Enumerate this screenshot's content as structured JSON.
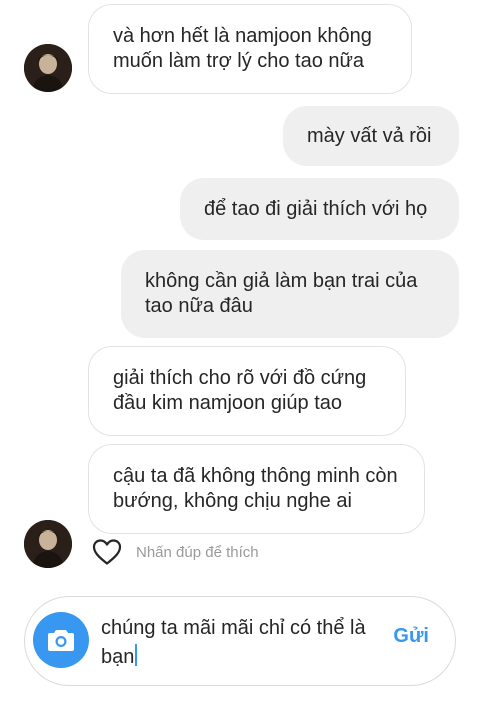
{
  "messages": [
    {
      "side": "incoming",
      "text": "và hơn hết là namjoon không muốn làm trợ lý cho tao nữa"
    },
    {
      "side": "outgoing",
      "text": "mày vất vả rồi"
    },
    {
      "side": "outgoing",
      "text": "để tao đi giải thích với họ"
    },
    {
      "side": "outgoing",
      "text": "không cần giả làm bạn trai của tao nữa đâu"
    },
    {
      "side": "incoming",
      "text": "giải thích cho rõ với đồ cứng đầu kim namjoon giúp tao"
    },
    {
      "side": "incoming",
      "text": "cậu ta đã không thông minh còn bướng, không chịu nghe ai"
    }
  ],
  "like_hint": "Nhấn đúp để thích",
  "composer": {
    "text": "chúng ta mãi mãi chỉ có thể là bạn",
    "send_label": "Gửi"
  },
  "icons": {
    "camera": "camera-icon",
    "like": "heart-outline-icon"
  },
  "colors": {
    "accent": "#3897f0",
    "incoming_border": "#e3e3e3",
    "outgoing_bg": "#efefef",
    "hint_text": "#9a9a9a"
  }
}
